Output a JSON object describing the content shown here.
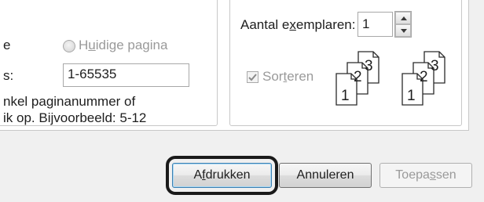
{
  "range": {
    "current_page_label_prefix": "H",
    "current_page_label_u": "u",
    "current_page_label_rest": "idige pagina",
    "pages_label_fragment": "s:",
    "pages_value": "1-65535",
    "help_line_1": "nkel paginanummer of",
    "help_line_2": "ik op. Bijvoorbeeld: 5-12",
    "cut_fragment_top": "e"
  },
  "copies": {
    "label_pre": "Aantal e",
    "label_u": "x",
    "label_post": "emplaren:",
    "value": "1",
    "collate_pre": "Sor",
    "collate_u": "t",
    "collate_post": "eren",
    "collate_checked": true,
    "collate_art": {
      "stack_labels": [
        "1",
        "2",
        "3"
      ]
    }
  },
  "buttons": {
    "print_pre": "A",
    "print_u": "f",
    "print_post": "drukken",
    "cancel": "Annuleren",
    "apply_pre": "Toepa",
    "apply_u": "s",
    "apply_post": "sen"
  },
  "colors": {
    "highlight": "#1a1a1a"
  }
}
